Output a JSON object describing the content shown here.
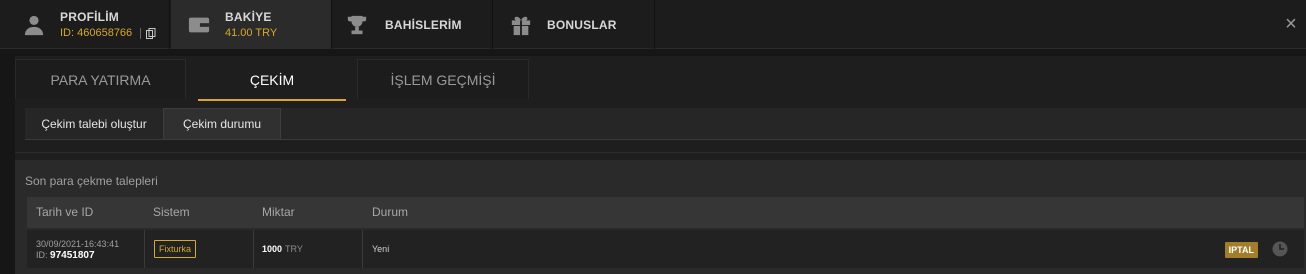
{
  "header": {
    "tabs": [
      {
        "label": "PROFİLİM",
        "sub": "ID: 460658766",
        "icon": "user-icon"
      },
      {
        "label": "BAKİYE",
        "sub": "41.00 TRY",
        "icon": "wallet-icon"
      },
      {
        "label": "BAHİSLERİM",
        "icon": "trophy-icon"
      },
      {
        "label": "BONUSLAR",
        "icon": "gift-icon"
      }
    ],
    "close": "×"
  },
  "subtabs": [
    "PARA YATIRMA",
    "ÇEKİM",
    "İŞLEM GEÇMİŞİ"
  ],
  "actions": [
    "Çekim talebi oluştur",
    "Çekim durumu"
  ],
  "list": {
    "title": "Son para çekme talepleri",
    "columns": [
      "Tarih ve ID",
      "Sistem",
      "Miktar",
      "Durum"
    ],
    "rows": [
      {
        "date": "30/09/2021-16:43:41",
        "id_label": "ID:",
        "id": "97451807",
        "system": "Fixturka",
        "amount": "1000",
        "currency": "TRY",
        "status": "Yeni",
        "cancel": "IPTAL"
      }
    ]
  },
  "colors": {
    "accent": "#d7a829",
    "cancel_bg": "#a27e2c"
  }
}
